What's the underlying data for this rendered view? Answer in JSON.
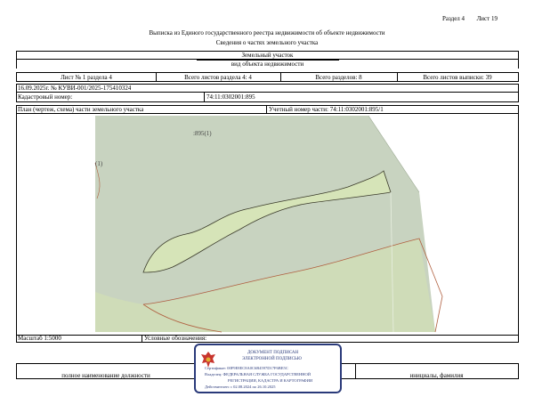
{
  "header": {
    "section_label": "Раздел 4",
    "sheet_label": "Лист 19"
  },
  "titles": {
    "main": "Выписка из Единого государственного реестра недвижимости об объекте недвижимости",
    "sub": "Сведения о частях земельного участка"
  },
  "object": {
    "type": "Земельный участок",
    "type_caption": "вид объекта недвижимости"
  },
  "sheet_info": {
    "sheet_no": "Лист № 1 раздела 4",
    "sheets_in_section": "Всего листов раздела 4: 4",
    "total_sections": "Всего разделов: 8",
    "total_sheets": "Всего листов выписки: 39"
  },
  "record": {
    "date_number": "16.09.2025г. № КУВИ-001/2025-175410324",
    "cadastral_label": "Кадастровый номер:",
    "cadastral_value": "74:11:0302001:895"
  },
  "plan": {
    "plan_label": "План (чертеж, схема) части земельного участка",
    "accounting_label": "Учетный номер части: 74:11:0302001:895/1",
    "map_labels": {
      "parcel_label": ":895(1)",
      "left_label": "(1)"
    },
    "colors": {
      "map_background": "#ffffff",
      "gray_zone": "#c8d3c0",
      "green_zone": "#d6e4b8",
      "light_green": "#dbe8c0",
      "boundary_red": "#b06040"
    }
  },
  "footer": {
    "scale_label": "Масштаб 1:5000",
    "legend_label": "Условные обозначения:",
    "position_caption": "полное наименование должности",
    "name_caption": "инициалы, фамилия"
  },
  "stamp": {
    "line1": "ДОКУМЕНТ ПОДПИСАН",
    "line2": "ЭЛЕКТРОННОЙ ПОДПИСЬЮ",
    "certificate": "Сертификат: 00F9E8EC8A0C6B4597D17F6BE5C",
    "owner": "Владелец: ФЕДЕРАЛЬНАЯ СЛУЖБА ГОСУДАРСТВЕННОЙ",
    "owner2": "РЕГИСТРАЦИИ, КАДАСТРА И КАРТОГРАФИИ",
    "validity": "Действителен: с 02.08.2024 по 26.10.2025",
    "emblem_icon": "eagle-emblem-icon"
  }
}
